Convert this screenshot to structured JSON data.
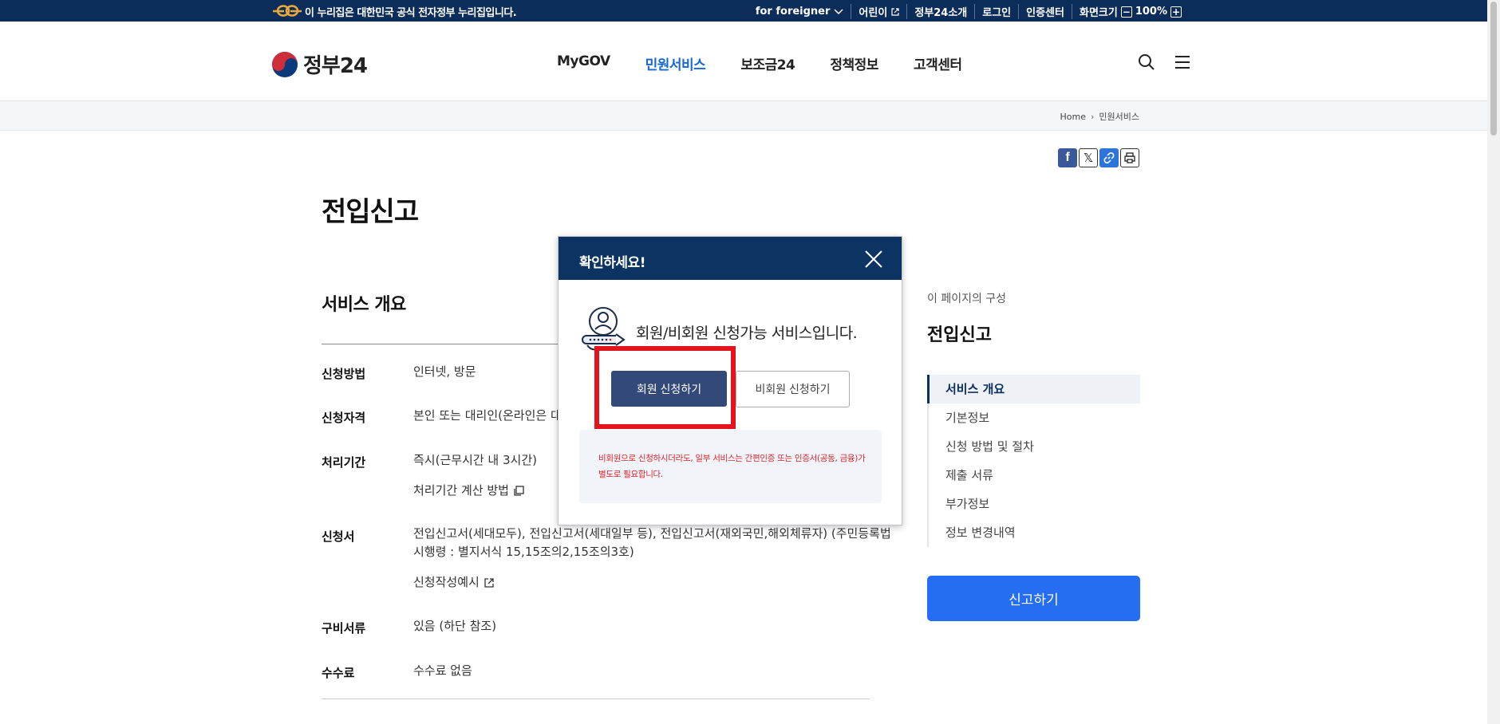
{
  "topbar": {
    "notice": "이 누리집은 대한민국 공식 전자정부 누리집입니다.",
    "foreigner": "for foreigner",
    "kids": "어린이",
    "about": "정부24소개",
    "login": "로그인",
    "cert": "인증센터",
    "screen_size": "화면크기",
    "zoom_minus": "−",
    "zoom_level": "100%",
    "zoom_plus": "+"
  },
  "header": {
    "logo": "정부24",
    "menu": [
      "MyGOV",
      "민원서비스",
      "보조금24",
      "정책정보",
      "고객센터"
    ],
    "active_menu": "민원서비스"
  },
  "breadcrumb": {
    "home": "Home",
    "current": "민원서비스"
  },
  "share": {
    "facebook": "f",
    "x": "𝕏"
  },
  "page": {
    "title": "전입신고",
    "section_title": "서비스 개요",
    "rows": {
      "method_label": "신청방법",
      "method_value": "인터넷, 방문",
      "qualification_label": "신청자격",
      "qualification_value": "본인 또는 대리인(온라인은 대리",
      "period_label": "처리기간",
      "period_value": "즉시(근무시간 내 3시간)",
      "period_link": "처리기간 계산 방법",
      "form_label": "신청서",
      "form_value_1": "전입신고서(세대모두), 전입신고서(세대일부 등), 전입신고서(재외국민,해외체류자) (주민등록법",
      "form_value_2": "시행령 : 별지서식 15,15조의2,15조의3호)",
      "form_link": "신청작성예시",
      "docs_label": "구비서류",
      "docs_value": "있음 (하단 참조)",
      "fee_label": "수수료",
      "fee_value": "수수료 없음"
    }
  },
  "toc": {
    "caption": "이 페이지의 구성",
    "title": "전입신고",
    "items": [
      "서비스 개요",
      "기본정보",
      "신청 방법 및 절차",
      "제출 서류",
      "부가정보",
      "정보 변경내역"
    ],
    "report_button": "신고하기"
  },
  "modal": {
    "title": "확인하세요!",
    "message": "회원/비회원 신청가능 서비스입니다.",
    "member_button": "회원 신청하기",
    "guest_button": "비회원 신청하기",
    "note": "비회원으로 신청하시더라도, 일부 서비스는 간편인증 또는 인증서(공동, 금융)가 별도로 필요합니다."
  },
  "colors": {
    "navy": "#0c2d5a",
    "accent_blue": "#1669d0",
    "primary_button": "#256ef4",
    "member_button": "#334a78",
    "highlight": "#e3141d",
    "note_text": "#e0242b"
  }
}
